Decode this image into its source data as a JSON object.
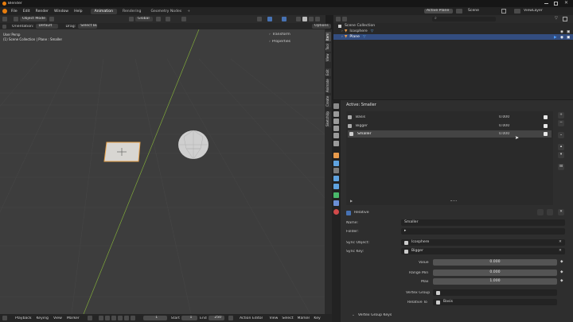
{
  "app": {
    "title": "Blender"
  },
  "menu": [
    "File",
    "Edit",
    "Render",
    "Window",
    "Help"
  ],
  "workspaces": [
    "Animation",
    "Rendering",
    "Geometry Nodes"
  ],
  "active_workspace": "Animation",
  "scene": {
    "label": "Scene",
    "value": "Scene"
  },
  "view_layer": "ViewLayer",
  "active_plane": "Active Plane",
  "viewport_header": {
    "mode": "Object Mode",
    "transform": "Global",
    "snap_icons": ""
  },
  "viewport_header2": {
    "orientation_label": "Orientation:",
    "orientation": "Default",
    "drag_label": "Drag:",
    "drag": "Select Box",
    "options": "Options"
  },
  "viewport": {
    "view_name": "User Persp",
    "collection_line": "(1) Scene Collection | Plane : Smaller",
    "npanel": [
      "Transform",
      "Properties"
    ]
  },
  "viewport_tabs": [
    "Item",
    "Tool",
    "View",
    "Edit",
    "Animate",
    "Create",
    "SketchUp"
  ],
  "outliner": {
    "search_placeholder": "",
    "rows": [
      {
        "name": "Scene Collection",
        "indent": 0
      },
      {
        "name": "Icosphere",
        "indent": 1
      },
      {
        "name": "Plane",
        "indent": 1,
        "selected": true
      }
    ]
  },
  "properties": {
    "active_label": "Active: Smaller",
    "shape_keys": [
      {
        "name": "Basis",
        "value": "0.000",
        "checked": true
      },
      {
        "name": "Bigger",
        "value": "0.000",
        "checked": true
      },
      {
        "name": "Smaller",
        "value": "0.000",
        "checked": true,
        "selected": true
      }
    ],
    "relative_label": "Relative",
    "relative_checked": true,
    "fields": {
      "name_label": "Name:",
      "name": "Smaller",
      "folder_label": "Folder:",
      "sync_object_label": "Sync Object:",
      "sync_object": "Icosphere",
      "sync_key_label": "Sync Key:",
      "sync_key": "Bigger",
      "value_label": "Value",
      "value": "0.000",
      "range_min_label": "Range Min",
      "range_min": "0.000",
      "max_label": "Max",
      "max": "1.000",
      "vertex_group_label": "Vertex Group",
      "relative_to_label": "Relative To",
      "relative_to": "Basis"
    },
    "vertex_group_keys": "Vertex Group Keys"
  },
  "timeline": {
    "items": [
      "Playback",
      "Keying",
      "View",
      "Marker"
    ],
    "current_frame": "1",
    "start_label": "Start",
    "start": "1",
    "end_label": "End",
    "end": "250",
    "editor": "Action Editor",
    "right_items": [
      "View",
      "Select",
      "Marker",
      "Key"
    ]
  }
}
